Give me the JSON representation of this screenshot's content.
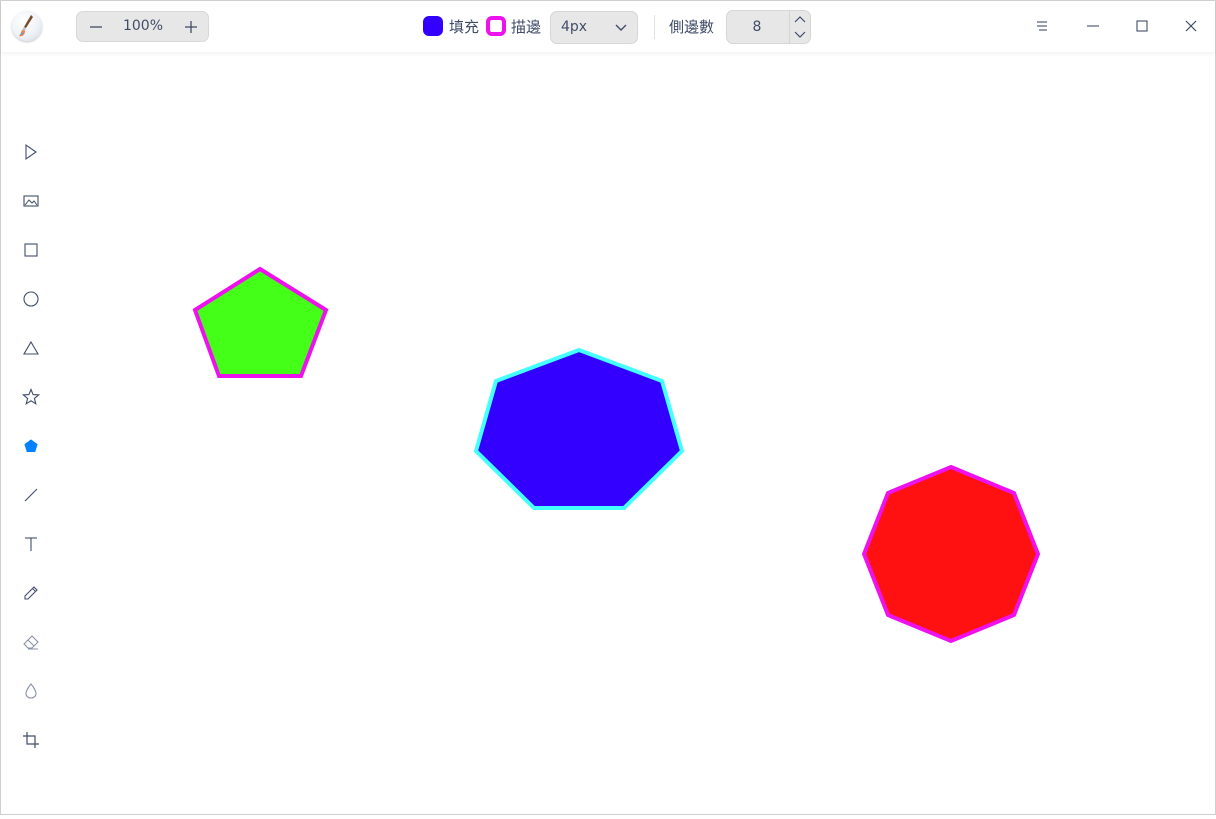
{
  "app": {
    "logo_icon": "drawing-app-logo-icon"
  },
  "zoom": {
    "value": "100%",
    "decrease_icon": "minus-icon",
    "increase_icon": "plus-icon"
  },
  "fill": {
    "label": "填充",
    "color": "#3300ff"
  },
  "stroke": {
    "label": "描邊",
    "color": "#ee11ee"
  },
  "line_width": {
    "selected": "4px"
  },
  "sides": {
    "label": "側邊數",
    "value": "8"
  },
  "window_controls": [
    "menu-icon",
    "minimize-icon",
    "maximize-icon",
    "close-icon"
  ],
  "tools": [
    {
      "name": "select",
      "icon": "select-cursor-icon"
    },
    {
      "name": "image",
      "icon": "image-icon"
    },
    {
      "name": "rectangle",
      "icon": "rectangle-icon"
    },
    {
      "name": "ellipse",
      "icon": "ellipse-icon"
    },
    {
      "name": "triangle",
      "icon": "triangle-icon"
    },
    {
      "name": "star",
      "icon": "star-icon"
    },
    {
      "name": "polygon",
      "icon": "polygon-icon",
      "active": true
    },
    {
      "name": "line",
      "icon": "line-icon"
    },
    {
      "name": "text",
      "icon": "text-icon"
    },
    {
      "name": "pencil",
      "icon": "pencil-icon"
    },
    {
      "name": "eraser",
      "icon": "eraser-icon"
    },
    {
      "name": "blur",
      "icon": "blur-drop-icon"
    },
    {
      "name": "crop",
      "icon": "crop-icon"
    }
  ],
  "canvas_shapes": [
    {
      "type": "pentagon",
      "sides": 5,
      "fill": "#44ff18",
      "stroke": "#ee11ee"
    },
    {
      "type": "heptagon",
      "sides": 7,
      "fill": "#3300ff",
      "stroke": "#44ffff"
    },
    {
      "type": "octagon",
      "sides": 8,
      "fill": "#ff1111",
      "stroke": "#ee11ee"
    }
  ],
  "colors": {
    "accent": "#0081ff",
    "icon": "#414d68"
  }
}
